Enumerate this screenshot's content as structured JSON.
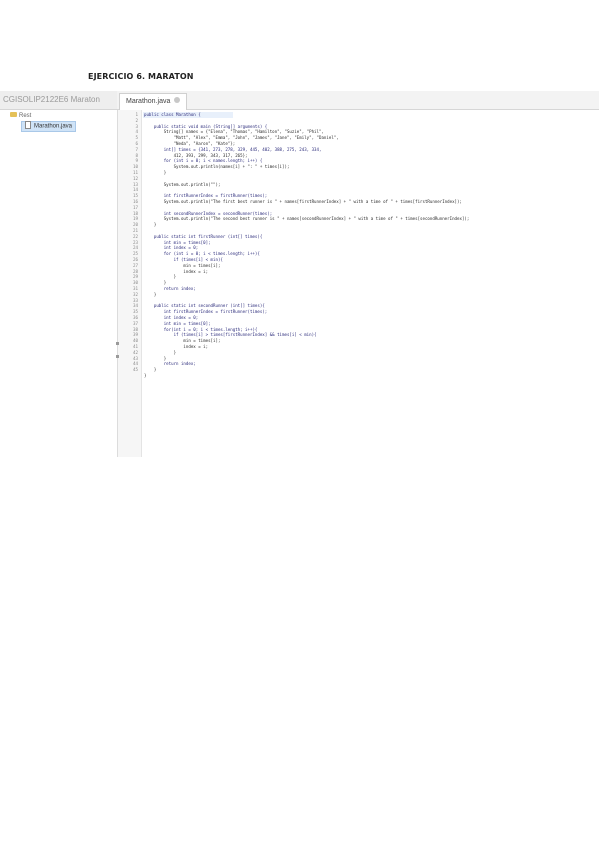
{
  "heading": "EJERCICIO 6. MARATON",
  "ide": {
    "project_name": "CGISOLIP2122E6 Maraton",
    "tab_label": "Marathon.java",
    "tree_root": "Rest",
    "tree_file": "Marathon.java"
  },
  "editor": {
    "line_numbers": [
      "1",
      "2",
      "3",
      "4",
      "5",
      "6",
      "7",
      "8",
      "9",
      "10",
      "11",
      "12",
      "13",
      "14",
      "15",
      "16",
      "17",
      "18",
      "19",
      "20",
      "21",
      "22",
      "23",
      "24",
      "25",
      "26",
      "27",
      "28",
      "29",
      "30",
      "31",
      "32",
      "33",
      "34",
      "35",
      "36",
      "37",
      "38",
      "39",
      "40",
      "41",
      "42",
      "43",
      "44",
      "45"
    ],
    "lines": [
      "public class Marathon {",
      "",
      "    public static void main (String[] arguments) {",
      "        String[] names = {\"Elena\", \"Thomas\", \"Hamilton\", \"Suzie\", \"Phil\",",
      "            \"Matt\", \"Alex\", \"Emma\", \"John\", \"James\", \"Jane\", \"Emily\", \"Daniel\",",
      "            \"Neda\", \"Aaron\", \"Kate\"};",
      "        int[] times = {341, 273, 278, 329, 445, 402, 388, 275, 243, 334,",
      "            412, 393, 299, 343, 317, 265};",
      "        for (int i = 0; i < names.length; i++) {",
      "            System.out.println(names[i] + \": \" + times[i]);",
      "        }",
      "",
      "        System.out.println(\"\");",
      "",
      "        int firstRunnerIndex = firstRunner(times);",
      "        System.out.println(\"The first best runner is \" + names[firstRunnerIndex] + \" with a time of \" + times[firstRunnerIndex]);",
      "",
      "        int secondRunnerIndex = secondRunner(times);",
      "        System.out.println(\"The second best runner is \" + names[secondRunnerIndex] + \" with a time of \" + times[secondRunnerIndex]);",
      "    }",
      "",
      "    public static int firstRunner (int[] times){",
      "        int min = times[0];",
      "        int index = 0;",
      "        for (int i = 0; i < times.length; i++){",
      "            if (times[i] < min){",
      "                min = times[i];",
      "                index = i;",
      "            }",
      "        }",
      "        return index;",
      "    }",
      "",
      "    public static int secondRunner (int[] times){",
      "        int firstRunnerIndex = firstRunner(times);",
      "        int index = 0;",
      "        int min = times[0];",
      "        for(int i = 0; i < times.length; i++){",
      "            if (times[i] > times[firstRunnerIndex] && times[i] < min){",
      "                min = times[i];",
      "                index = i;",
      "            }",
      "        }",
      "        return index;",
      "    }",
      "}"
    ]
  }
}
